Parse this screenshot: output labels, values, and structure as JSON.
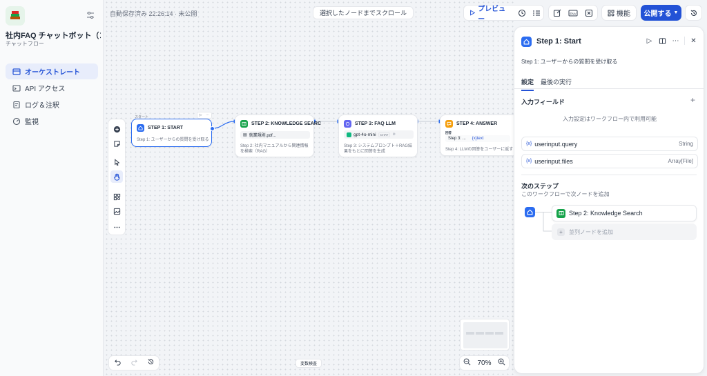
{
  "sidebar": {
    "app_icon": "books-icon",
    "title": "社内FAQ チャットボット（コ...",
    "subtitle": "チャットフロー",
    "items": [
      {
        "label": "オーケストレート",
        "icon": "layout-icon",
        "active": true
      },
      {
        "label": "API アクセス",
        "icon": "terminal-icon",
        "active": false
      },
      {
        "label": "ログ＆注釈",
        "icon": "log-icon",
        "active": false
      },
      {
        "label": "監視",
        "icon": "monitor-icon",
        "active": false
      }
    ]
  },
  "header": {
    "autosave": "自動保存済み 22:26:14 · 未公開",
    "scroll_to_selected": "選択したノードまでスクロール",
    "preview": "プレビュー",
    "feature": "機能",
    "publish": "公開する"
  },
  "nodes": {
    "start_label": "スタート",
    "step1": {
      "title": "STEP 1: START",
      "desc": "Step 1: ユーザーからの質問を受け取る"
    },
    "step2": {
      "title": "STEP 2: KNOWLEDGE SEARC",
      "chip": "就業規則.pdf...",
      "desc": "Step 2: 社内マニュアルから関連情報を検索（RAG）"
    },
    "step3": {
      "title": "STEP 3: FAQ LLM",
      "model": "gpt-4o-mini",
      "model_tag": "CHAT",
      "desc": "Step 3: システムプロンプト＋RAG結果をもとに回答を生成"
    },
    "step4": {
      "title": "STEP 4: ANSWER",
      "answer_label": "回答",
      "answer_ref": "Step 3: ...",
      "answer_var": "{x}text",
      "desc": "Step 4: LLMの回答をユーザーに返す"
    }
  },
  "canvas": {
    "variable_check": "変数検査",
    "zoom": "70%"
  },
  "panel": {
    "title": "Step 1: Start",
    "desc": "Step 1: ユーザーからの質問を受け取る",
    "tabs": [
      "設定",
      "最後の実行"
    ],
    "input_fields_title": "入力フィールド",
    "input_note": "入力設定はワークフロー内で利用可能",
    "variables": [
      {
        "name": "userinput.query",
        "type": "String"
      },
      {
        "name": "userinput.files",
        "type": "Array[File]"
      }
    ],
    "next_step_title": "次のステップ",
    "next_step_sub": "このワークフローで次ノードを追加",
    "next_node": "Step 2: Knowledge Search",
    "add_parallel": "並列ノードを追加"
  },
  "colors": {
    "accent": "#2352d6",
    "start_node": "#2b6cf0",
    "knowledge_node": "#16a34a",
    "llm_node": "#6366f1",
    "answer_node": "#f59e0b"
  }
}
